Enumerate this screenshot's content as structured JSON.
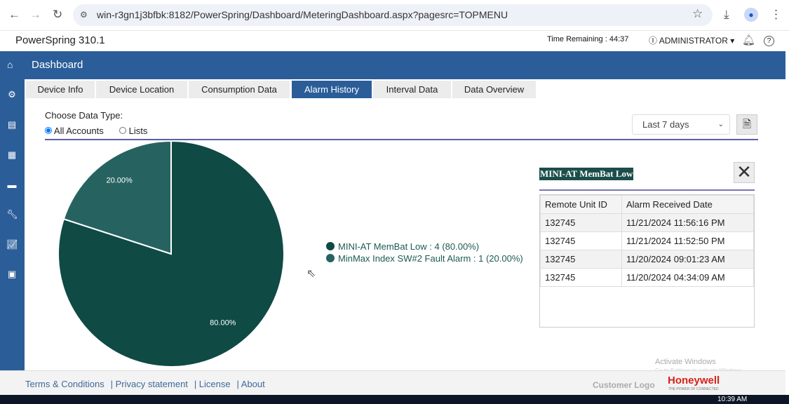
{
  "browser": {
    "url": "win-r3gn1j3bfbk:8182/PowerSpring/Dashboard/MeteringDashboard.aspx?pagesrc=TOPMENU"
  },
  "app": {
    "brand": "PowerSpring 310.1",
    "time_remaining": "Time Remaining : 44:37",
    "user": "ADMINISTRATOR",
    "help": "?"
  },
  "header": {
    "title": "Dashboard"
  },
  "tabs": [
    {
      "label": "Device Info"
    },
    {
      "label": "Device Location"
    },
    {
      "label": "Consumption Data"
    },
    {
      "label": "Alarm History",
      "active": true
    },
    {
      "label": "Interval Data"
    },
    {
      "label": "Data Overview"
    }
  ],
  "filters": {
    "choose_label": "Choose Data Type:",
    "opt_all": "All Accounts",
    "opt_lists": "Lists",
    "range": "Last 7 days"
  },
  "chart_data": {
    "type": "pie",
    "slices": [
      {
        "label": "MINI-AT MemBat Low",
        "count": 4,
        "percent": 80.0,
        "display": "80.00%",
        "legend": "MINI-AT MemBat Low : 4 (80.00%)",
        "color": "#0f4a45"
      },
      {
        "label": "MinMax Index SW#2 Fault Alarm",
        "count": 1,
        "percent": 20.0,
        "display": "20.00%",
        "legend": "MinMax Index SW#2 Fault Alarm : 1 (20.00%)",
        "color": "#266360"
      }
    ]
  },
  "panel": {
    "title": "MINI-AT MemBat Low",
    "columns": [
      "Remote Unit ID",
      "Alarm Received Date"
    ],
    "rows": [
      [
        "132745",
        "11/21/2024 11:56:16 PM"
      ],
      [
        "132745",
        "11/21/2024 11:52:50 PM"
      ],
      [
        "132745",
        "11/20/2024 09:01:23 AM"
      ],
      [
        "132745",
        "11/20/2024 04:34:09 AM"
      ]
    ]
  },
  "footer": {
    "links": [
      "Terms & Conditions",
      "| Privacy statement",
      "| License",
      "| About"
    ],
    "customer_logo": "Customer Logo",
    "honeywell": "Honeywell",
    "tagline": "THE POWER OF CONNECTED"
  },
  "watermark": {
    "line1": "Activate Windows",
    "line2": "Go to Settings to activate Windows."
  },
  "taskbar": {
    "time": "10:39 AM"
  }
}
